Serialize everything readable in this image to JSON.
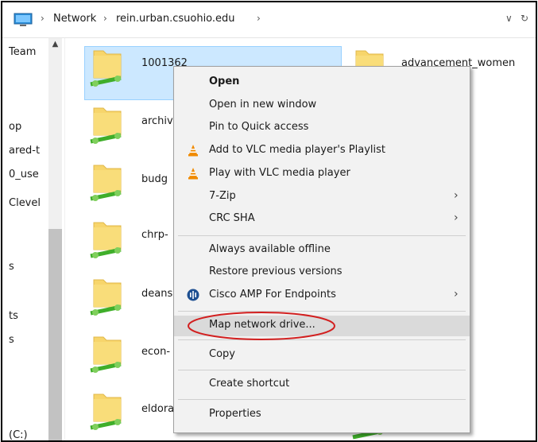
{
  "address": {
    "breadcrumbs": [
      "Network",
      "rein.urban.csuohio.edu"
    ],
    "refresh_glyph": "↻",
    "dropdown_glyph": "∨"
  },
  "navpane": {
    "items": [
      "Team",
      "op",
      "ared-t",
      "0_use",
      "Clevel",
      "s",
      "ts",
      "s",
      "(C:)"
    ]
  },
  "content": {
    "items": [
      {
        "name": "1001362"
      },
      {
        "name": "advancement_women"
      },
      {
        "name": "archiv"
      },
      {
        "name": "budg"
      },
      {
        "name": "chrp-"
      },
      {
        "name": "deans"
      },
      {
        "name": "econ-"
      },
      {
        "name": "eldora"
      }
    ]
  },
  "context_menu": {
    "items": [
      {
        "label": "Open"
      },
      {
        "label": "Open in new window"
      },
      {
        "label": "Pin to Quick access"
      },
      {
        "label": "Add to VLC media player's Playlist"
      },
      {
        "label": "Play with VLC media player"
      },
      {
        "label": "7-Zip"
      },
      {
        "label": "CRC SHA"
      },
      {
        "label": "Always available offline"
      },
      {
        "label": "Restore previous versions"
      },
      {
        "label": "Cisco AMP For Endpoints"
      },
      {
        "label": "Map network drive..."
      },
      {
        "label": "Copy"
      },
      {
        "label": "Create shortcut"
      },
      {
        "label": "Properties"
      }
    ],
    "submenu_glyph": "›"
  },
  "colors": {
    "selection": "#cce8ff",
    "menu_bg": "#f2f2f2",
    "menu_hover": "#dadada",
    "annotation": "#d21f1f",
    "folder": "#f7d56b",
    "network_green": "#3fae2a"
  }
}
